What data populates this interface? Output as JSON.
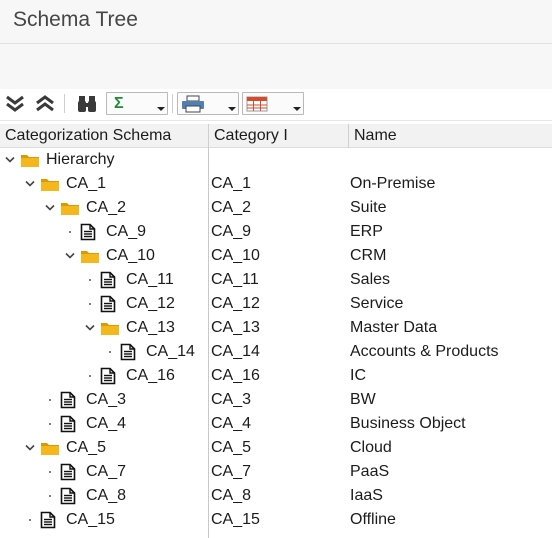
{
  "window": {
    "title": "Schema Tree"
  },
  "toolbar": {
    "buttons": [
      {
        "name": "collapse-all-button",
        "icon": "double-chevron-down-icon"
      },
      {
        "name": "expand-all-button",
        "icon": "double-chevron-up-icon"
      },
      {
        "name": "find-button",
        "icon": "binoculars-icon"
      },
      {
        "name": "sum-dropdown",
        "icon": "sigma-icon",
        "label": "Σ"
      },
      {
        "name": "print-dropdown",
        "icon": "printer-icon"
      },
      {
        "name": "layout-dropdown",
        "icon": "table-layout-icon"
      }
    ]
  },
  "columns": [
    "Categorization Schema",
    "Category I",
    "Name"
  ],
  "tree": [
    {
      "label": "Hierarchy",
      "level": 0,
      "type": "folder",
      "state": "expanded",
      "category": "",
      "name": ""
    },
    {
      "label": "CA_1",
      "level": 1,
      "type": "folder",
      "state": "expanded",
      "category": "CA_1",
      "name": "On-Premise"
    },
    {
      "label": "CA_2",
      "level": 2,
      "type": "folder",
      "state": "expanded",
      "category": "CA_2",
      "name": "Suite"
    },
    {
      "label": "CA_9",
      "level": 3,
      "type": "doc",
      "state": "leaf",
      "category": "CA_9",
      "name": "ERP"
    },
    {
      "label": "CA_10",
      "level": 3,
      "type": "folder",
      "state": "expanded",
      "category": "CA_10",
      "name": "CRM"
    },
    {
      "label": "CA_11",
      "level": 4,
      "type": "doc",
      "state": "leaf",
      "category": "CA_11",
      "name": "Sales"
    },
    {
      "label": "CA_12",
      "level": 4,
      "type": "doc",
      "state": "leaf",
      "category": "CA_12",
      "name": "Service"
    },
    {
      "label": "CA_13",
      "level": 4,
      "type": "folder",
      "state": "expanded",
      "category": "CA_13",
      "name": "Master Data"
    },
    {
      "label": "CA_14",
      "level": 5,
      "type": "doc",
      "state": "leaf",
      "category": "CA_14",
      "name": "Accounts & Products"
    },
    {
      "label": "CA_16",
      "level": 4,
      "type": "doc",
      "state": "leaf",
      "category": "CA_16",
      "name": "IC"
    },
    {
      "label": "CA_3",
      "level": 2,
      "type": "doc",
      "state": "leaf",
      "category": "CA_3",
      "name": "BW"
    },
    {
      "label": "CA_4",
      "level": 2,
      "type": "doc",
      "state": "leaf",
      "category": "CA_4",
      "name": "Business Object"
    },
    {
      "label": "CA_5",
      "level": 1,
      "type": "folder",
      "state": "expanded",
      "category": "CA_5",
      "name": "Cloud"
    },
    {
      "label": "CA_7",
      "level": 2,
      "type": "doc",
      "state": "leaf",
      "category": "CA_7",
      "name": "PaaS"
    },
    {
      "label": "CA_8",
      "level": 2,
      "type": "doc",
      "state": "leaf",
      "category": "CA_8",
      "name": "IaaS"
    },
    {
      "label": "CA_15",
      "level": 1,
      "type": "doc",
      "state": "leaf",
      "category": "CA_15",
      "name": "Offline"
    }
  ],
  "colors": {
    "folder": "#f5b81c",
    "folder_dark": "#d99a06",
    "header_bg": "#f2f2f2",
    "title_bg": "#f7f7f7"
  }
}
